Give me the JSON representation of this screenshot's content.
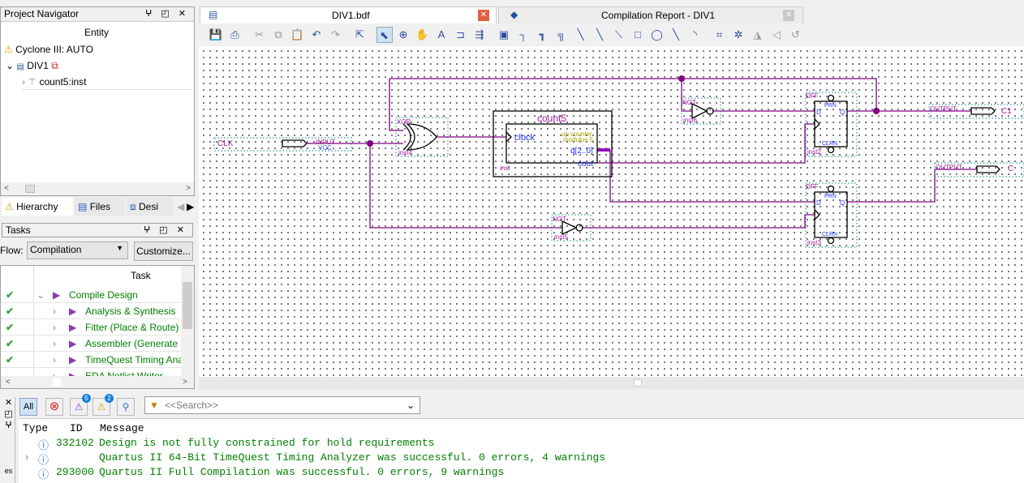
{
  "project_navigator": {
    "title": "Project Navigator",
    "column": "Entity",
    "device": "Cyclone III: AUTO",
    "top_entity": "DIV1",
    "child": "count5:inst",
    "tabs": [
      "Hierarchy",
      "Files",
      "Desi"
    ]
  },
  "tasks": {
    "title": "Tasks",
    "flow_label": "Flow:",
    "flow_value": "Compilation",
    "customize": "Customize...",
    "column": "Task",
    "items": [
      {
        "label": "Compile Design",
        "done": true
      },
      {
        "label": "Analysis & Synthesis",
        "done": true
      },
      {
        "label": "Fitter (Place & Route)",
        "done": true
      },
      {
        "label": "Assembler (Generate programming files)",
        "done": true
      },
      {
        "label": "TimeQuest Timing Analysis",
        "done": true
      },
      {
        "label": "EDA Netlist Writer",
        "done": false
      }
    ]
  },
  "editor_tabs": [
    {
      "label": "DIV1.bdf",
      "active": true
    },
    {
      "label": "Compilation Report - DIV1",
      "active": false
    }
  ],
  "toolbar_icons": [
    "save-icon",
    "print-icon",
    "cut-icon",
    "copy-icon",
    "paste-icon",
    "undo-icon",
    "redo-icon",
    "hierarchy-up-icon",
    "selection-tool-icon",
    "zoom-tool-icon",
    "hand-tool-icon",
    "text-tool-icon",
    "symbol-tool-icon",
    "pin-tool-icon",
    "block-tool-icon",
    "orthogonal-node-icon",
    "orthogonal-bus-icon",
    "orthogonal-conduit-icon",
    "node-tool-icon",
    "bus-tool-icon",
    "conduit-tool-icon",
    "rectangle-tool-icon",
    "oval-tool-icon",
    "line-tool-icon",
    "arc-tool-icon",
    "partial-line-select-icon",
    "rubberbanding-icon",
    "flip-horizontal-icon",
    "flip-vertical-icon",
    "rotate-icon"
  ],
  "schematic": {
    "input_pin": {
      "name": "CLK",
      "type": "INPUT",
      "default": "VCC"
    },
    "xor": {
      "type": "XOR",
      "inst": "inst4"
    },
    "counter": {
      "title": "count5",
      "port_clock": "clock",
      "desc1": "up counter",
      "desc2": "modulus 5",
      "port_q": "q[2..0]",
      "port_cout": "cout",
      "inst": "inst"
    },
    "not1": {
      "type": "NOT",
      "inst": "inst6"
    },
    "not2": {
      "type": "NOT",
      "inst": "inst5"
    },
    "dff1": {
      "type": "DFF",
      "inst": "inst2",
      "prn": "PRN",
      "clrn": "CLRN",
      "d": "D",
      "q": "Q"
    },
    "dff2": {
      "type": "DFF",
      "inst": "inst3",
      "prn": "PRN",
      "clrn": "CLRN",
      "d": "D",
      "q": "Q"
    },
    "out1": {
      "type": "OUTPUT",
      "name": "C1"
    },
    "out2": {
      "type": "OUTPUT",
      "name": "C"
    }
  },
  "messages": {
    "filters": {
      "all": "All",
      "warning_count_critical": "5",
      "warning_count": "2"
    },
    "search_placeholder": "<<Search>>",
    "columns": [
      "Type",
      "ID",
      "Message"
    ],
    "rows": [
      {
        "id": "332102",
        "text": "Design is not fully constrained for hold requirements"
      },
      {
        "id": "",
        "text": "Quartus II 64-Bit TimeQuest Timing Analyzer was successful. 0 errors, 4 warnings"
      },
      {
        "id": "293000",
        "text": "Quartus II Full Compilation was successful. 0 errors, 9 warnings"
      }
    ],
    "side_label": "es"
  }
}
